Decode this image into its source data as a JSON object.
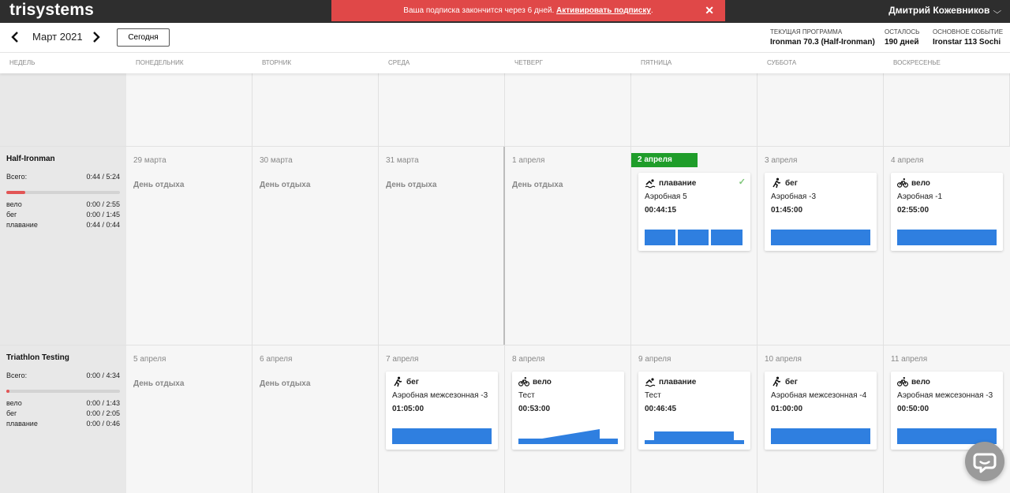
{
  "app": {
    "logo": "trisystems",
    "banner_text": "Ваша подписка закончится через 6 дней.",
    "banner_link": "Активировать подписку",
    "banner_dot": ".",
    "banner_close": "✕",
    "user_name": "Дмитрий Кожевников"
  },
  "toolbar": {
    "prev": "‹",
    "next": "›",
    "month": "Март 2021",
    "today": "Сегодня",
    "program_label": "Текущая программа",
    "program_value": "Ironman 70.3 (Half-Ironman)",
    "left_label": "Осталось",
    "left_value": "190 дней",
    "event_label": "Основное событие",
    "event_value": "Ironstar 113 Sochi"
  },
  "days": [
    "Недель",
    "Понедельник",
    "Вторник",
    "Среда",
    "Четверг",
    "Пятница",
    "Суббота",
    "Воскресенье"
  ],
  "colors": {
    "workout": "#2f7fe0",
    "today": "#1f9d2a",
    "progress": "#e25555"
  },
  "weeks": [
    {
      "title": "Half-Ironman",
      "total_label": "Всего:",
      "total": "0:44 / 5:24",
      "progress": 0.17,
      "sports": [
        {
          "name": "вело",
          "value": "0:00 / 2:55"
        },
        {
          "name": "бег",
          "value": "0:00 / 1:45"
        },
        {
          "name": "плавание",
          "value": "0:44 / 0:44"
        }
      ],
      "dates": [
        "29 марта",
        "30 марта",
        "31 марта",
        "1 апреля",
        "2 апреля",
        "3 апреля",
        "4 апреля"
      ],
      "rest_label": "День отдыха",
      "cards": [
        {
          "sport": "плавание",
          "icon": "swim-icon",
          "name": "Аэробная 5",
          "time": "00:44:15",
          "done": "✓"
        },
        {
          "sport": "бег",
          "icon": "run-icon",
          "name": "Аэробная -3",
          "time": "01:45:00"
        },
        {
          "sport": "вело",
          "icon": "bike-icon",
          "name": "Аэробная -1",
          "time": "02:55:00"
        }
      ]
    },
    {
      "title": "Triathlon Testing",
      "total_label": "Всего:",
      "total": "0:00 / 4:34",
      "progress": 0.03,
      "sports": [
        {
          "name": "вело",
          "value": "0:00 / 1:43"
        },
        {
          "name": "бег",
          "value": "0:00 / 2:05"
        },
        {
          "name": "плавание",
          "value": "0:00 / 0:46"
        }
      ],
      "dates": [
        "5 апреля",
        "6 апреля",
        "7 апреля",
        "8 апреля",
        "9 апреля",
        "10 апреля",
        "11 апреля"
      ],
      "rest_label": "День отдыха",
      "cards": [
        {
          "sport": "бег",
          "icon": "run-icon",
          "name": "Аэробная межсезонная -3",
          "time": "01:05:00"
        },
        {
          "sport": "вело",
          "icon": "bike-icon",
          "name": "Тест",
          "time": "00:53:00"
        },
        {
          "sport": "плавание",
          "icon": "swim-icon",
          "name": "Тест",
          "time": "00:46:45"
        },
        {
          "sport": "бег",
          "icon": "run-icon",
          "name": "Аэробная межсезонная -4",
          "time": "01:00:00"
        },
        {
          "sport": "вело",
          "icon": "bike-icon",
          "name": "Аэробная межсезонная -3",
          "time": "00:50:00"
        }
      ]
    }
  ]
}
